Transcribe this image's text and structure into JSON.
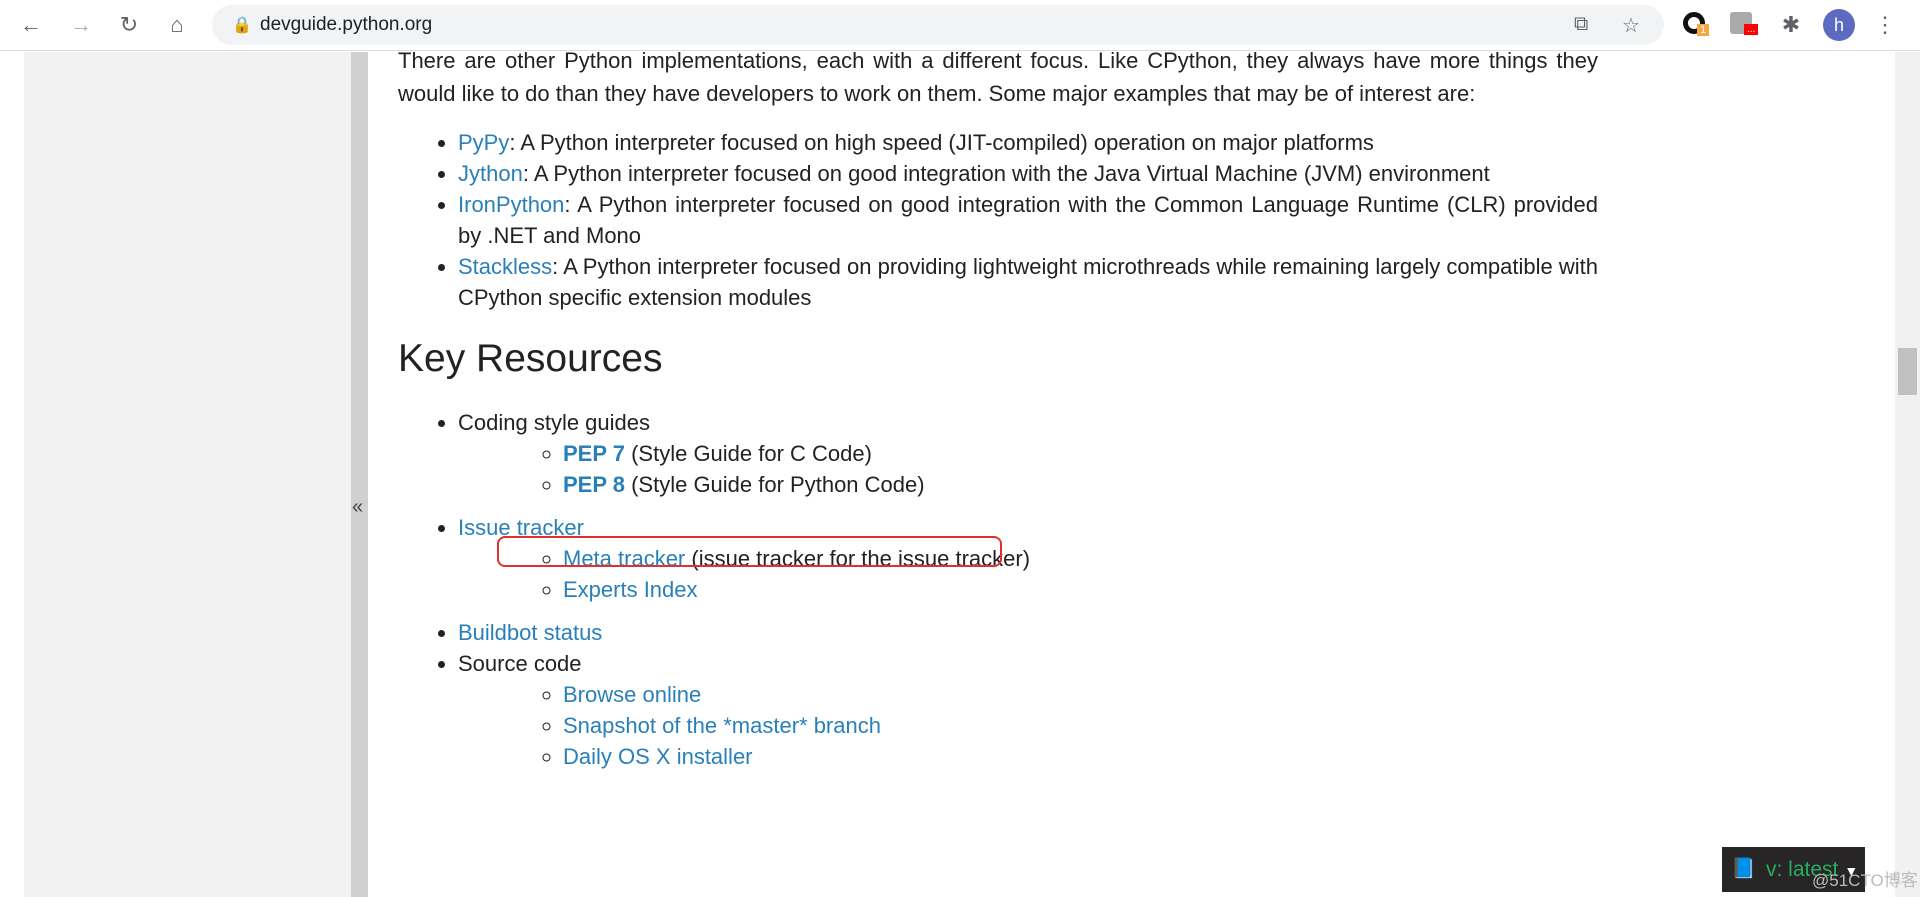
{
  "browser": {
    "url": "devguide.python.org",
    "profile_initial": "h",
    "ext_badges": [
      "1",
      "..."
    ]
  },
  "intro": "There are other Python implementations, each with a different focus. Like CPython, they always have more things they would like to do than they have developers to work on them. Some major examples that may be of interest are:",
  "implementations": [
    {
      "name": "PyPy",
      "desc": ": A Python interpreter focused on high speed (JIT-compiled) operation on major platforms"
    },
    {
      "name": "Jython",
      "desc": ": A Python interpreter focused on good integration with the Java Virtual Machine (JVM) environment"
    },
    {
      "name": "IronPython",
      "desc": ": A Python interpreter focused on good integration with the Common Language Runtime (CLR) provided by .NET and Mono"
    },
    {
      "name": "Stackless",
      "desc": ": A Python interpreter focused on providing lightweight microthreads while remaining largely compatible with CPython specific extension modules"
    }
  ],
  "heading": "Key Resources",
  "resources": {
    "style": {
      "label": "Coding style guides",
      "items": [
        {
          "link": "PEP 7",
          "text": " (Style Guide for C Code)"
        },
        {
          "link": "PEP 8",
          "text": " (Style Guide for Python Code)"
        }
      ]
    },
    "issue": {
      "label": "Issue tracker",
      "items": [
        {
          "link": "Meta tracker",
          "text": " (issue tracker for the issue tracker)"
        },
        {
          "link": "Experts Index",
          "text": ""
        }
      ]
    },
    "buildbot": "Buildbot status",
    "source": {
      "label": "Source code",
      "items": [
        "Browse online",
        "Snapshot of the *master* branch",
        "Daily OS X installer"
      ]
    }
  },
  "sidebar_toggle": "«",
  "version": "v: latest",
  "watermark": "@51CTO博客"
}
